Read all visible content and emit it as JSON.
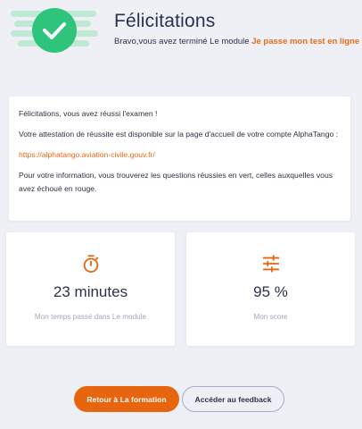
{
  "header": {
    "title": "Félicitations",
    "subtitle_prefix": "Bravo,vous avez terminé Le module ",
    "module_name": "Je passe mon test en ligne"
  },
  "message": {
    "line1": "Félicitations, vous avez réussi l'examen !",
    "line2": "Votre attestation de réussite est disponible sur la page d'accueil de votre compte AlphaTango :",
    "link": "https://alphatango.aviation-civile.gouv.fr/",
    "line3": "Pour votre information, vous trouverez les questions réussies en vert, celles auxquelles vous avez échoué en rouge."
  },
  "stats": {
    "time": {
      "value": "23 minutes",
      "caption": "Mon temps passé dans Le module",
      "icon": "stopwatch-icon"
    },
    "score": {
      "value": "95 %",
      "caption": "Mon score",
      "icon": "sliders-icon"
    }
  },
  "buttons": {
    "back": "Retour à La formation",
    "feedback": "Accéder au feedback"
  },
  "colors": {
    "accent": "#e8650f",
    "success": "#2fc47c",
    "background": "#eef0f6"
  }
}
